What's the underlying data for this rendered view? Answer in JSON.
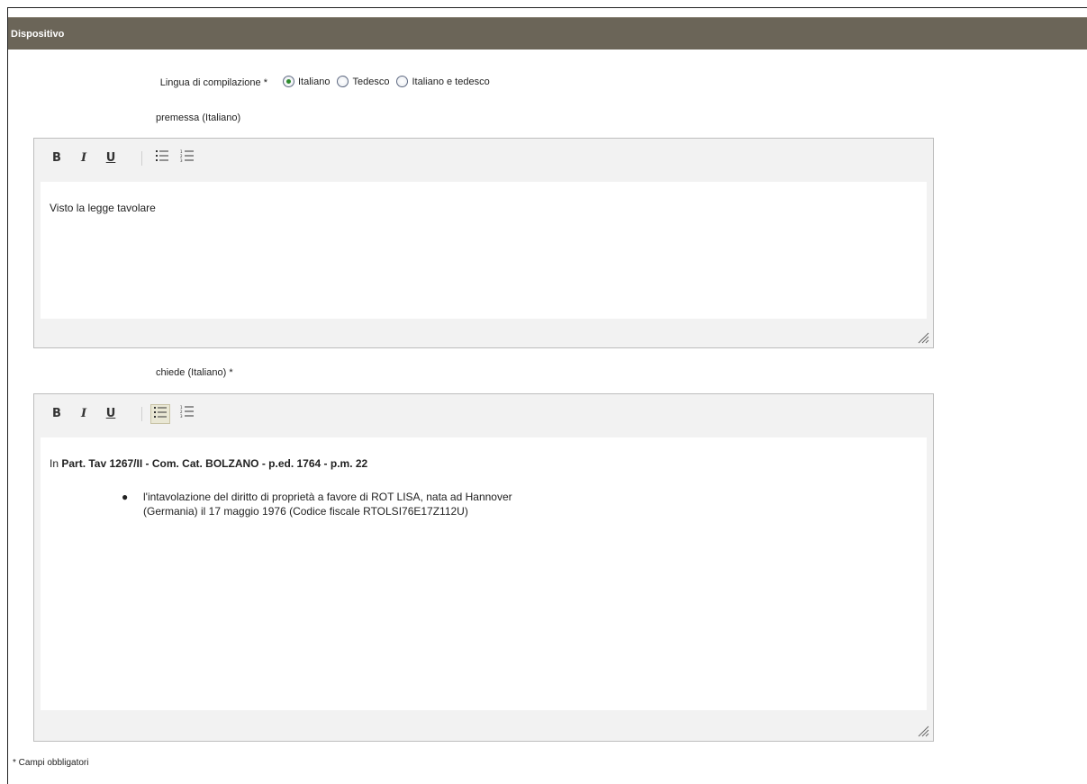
{
  "header": {
    "title": "Dispositivo"
  },
  "language": {
    "label": "Lingua di compilazione *",
    "options": [
      {
        "label": "Italiano",
        "checked": true
      },
      {
        "label": "Tedesco",
        "checked": false
      },
      {
        "label": "Italiano e tedesco",
        "checked": false
      }
    ]
  },
  "premessa": {
    "label": "premessa (Italiano)",
    "toolbar": {
      "bold": "B",
      "italic": "I",
      "underline": "U",
      "bullet_icon": "bulleted-list-icon",
      "numbered_icon": "numbered-list-icon"
    },
    "content": "Visto la legge tavolare"
  },
  "chiede": {
    "label": "chiede (Italiano) *",
    "toolbar": {
      "bold": "B",
      "italic": "I",
      "underline": "U",
      "bullet_icon": "bulleted-list-icon",
      "numbered_icon": "numbered-list-icon"
    },
    "content_prefix": "In ",
    "content_bold": "Part. Tav 1267/II - Com. Cat. BOLZANO - p.ed. 1764 - p.m. 22",
    "bullet_line1": "l'intavolazione del diritto di proprietà a favore di ROT LISA, nata ad Hannover",
    "bullet_line2": "(Germania) il 17 maggio 1976 (Codice fiscale RTOLSI76E17Z112U)"
  },
  "footnote": "* Campi obbligatori"
}
